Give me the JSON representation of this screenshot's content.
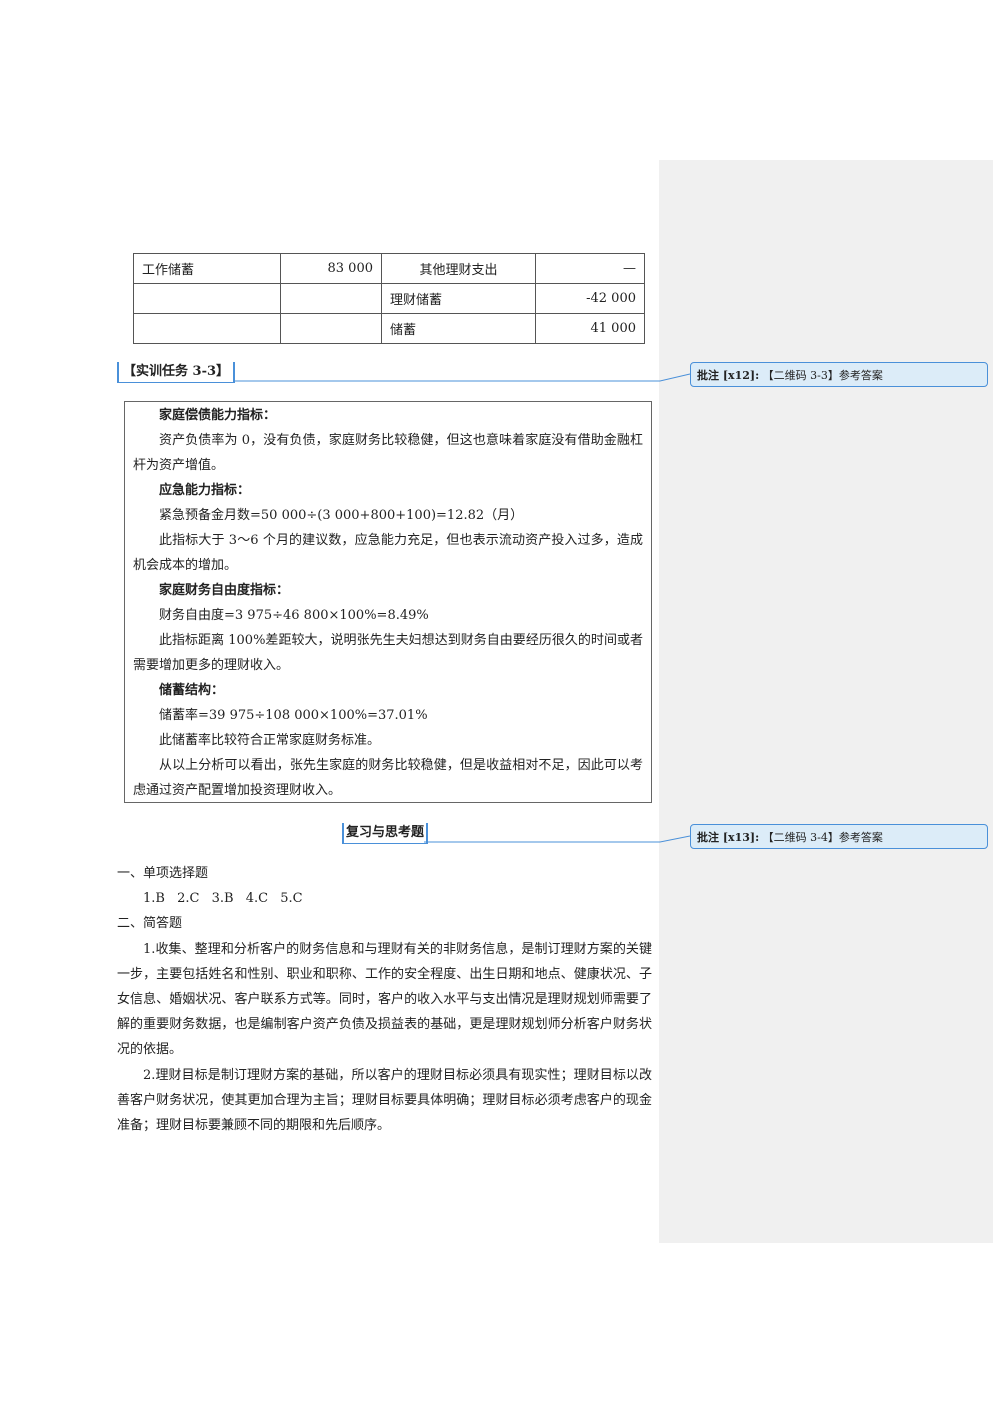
{
  "table": {
    "rows": [
      [
        "工作储蓄",
        "83 000",
        "其他理财支出",
        "—"
      ],
      [
        "",
        "",
        "理财储蓄",
        "-42 000"
      ],
      [
        "",
        "",
        "储蓄",
        "41 000"
      ]
    ]
  },
  "task_heading": "【实训任务 3-3】",
  "answer": {
    "paragraphs": [
      {
        "text": "家庭偿债能力指标：",
        "bold": true
      },
      {
        "text": "资产负债率为 0，没有负债，家庭财务比较稳健，但这也意味着家庭没有借助金融杠杆为资产增值。",
        "bold": false
      },
      {
        "text": "应急能力指标：",
        "bold": true
      },
      {
        "text": "紧急预备金月数=50 000÷(3 000+800+100)=12.82（月）",
        "bold": false
      },
      {
        "text": "此指标大于 3～6 个月的建议数，应急能力充足，但也表示流动资产投入过多，造成机会成本的增加。",
        "bold": false
      },
      {
        "text": "家庭财务自由度指标：",
        "bold": true
      },
      {
        "text": "财务自由度=3 975÷46 800×100%=8.49%",
        "bold": false
      },
      {
        "text": "此指标距离 100%差距较大，说明张先生夫妇想达到财务自由要经历很久的时间或者需要增加更多的理财收入。",
        "bold": false
      },
      {
        "text": "储蓄结构：",
        "bold": true
      },
      {
        "text": "储蓄率=39 975÷108 000×100%=37.01%",
        "bold": false
      },
      {
        "text": "此储蓄率比较符合正常家庭财务标准。",
        "bold": false
      },
      {
        "text": "从以上分析可以看出，张先生家庭的财务比较稳健，但是收益相对不足，因此可以考虑通过资产配置增加投资理财收入。",
        "bold": false
      }
    ]
  },
  "review_heading": "复习与思考题",
  "section1": {
    "title": "一、单项选择题",
    "choices": [
      "1.B",
      "2.C",
      "3.B",
      "4.C",
      "5.C"
    ]
  },
  "section2": {
    "title": "二、简答题",
    "answers": [
      "1.收集、整理和分析客户的财务信息和与理财有关的非财务信息，是制订理财方案的关键一步，主要包括姓名和性别、职业和职称、工作的安全程度、出生日期和地点、健康状况、子女信息、婚姻状况、客户联系方式等。同时，客户的收入水平与支出情况是理财规划师需要了解的重要财务数据，也是编制客户资产负债及损益表的基础，更是理财规划师分析客户财务状况的依据。",
      "2.理财目标是制订理财方案的基础，所以客户的理财目标必须具有现实性；理财目标以改善客户财务状况，使其更加合理为主旨；理财目标要具体明确；理财目标必须考虑客户的现金准备；理财目标要兼顾不同的期限和先后顺序。"
    ]
  },
  "comments": [
    {
      "label": "批注 [x12]:",
      "text": "【二维码 3-3】参考答案"
    },
    {
      "label": "批注 [x13]:",
      "text": "【二维码 3-4】参考答案"
    }
  ],
  "colors": {
    "comment_bg": "#dcecf8",
    "comment_border": "#4a90d9",
    "margin_pane": "#f0f0f0"
  }
}
